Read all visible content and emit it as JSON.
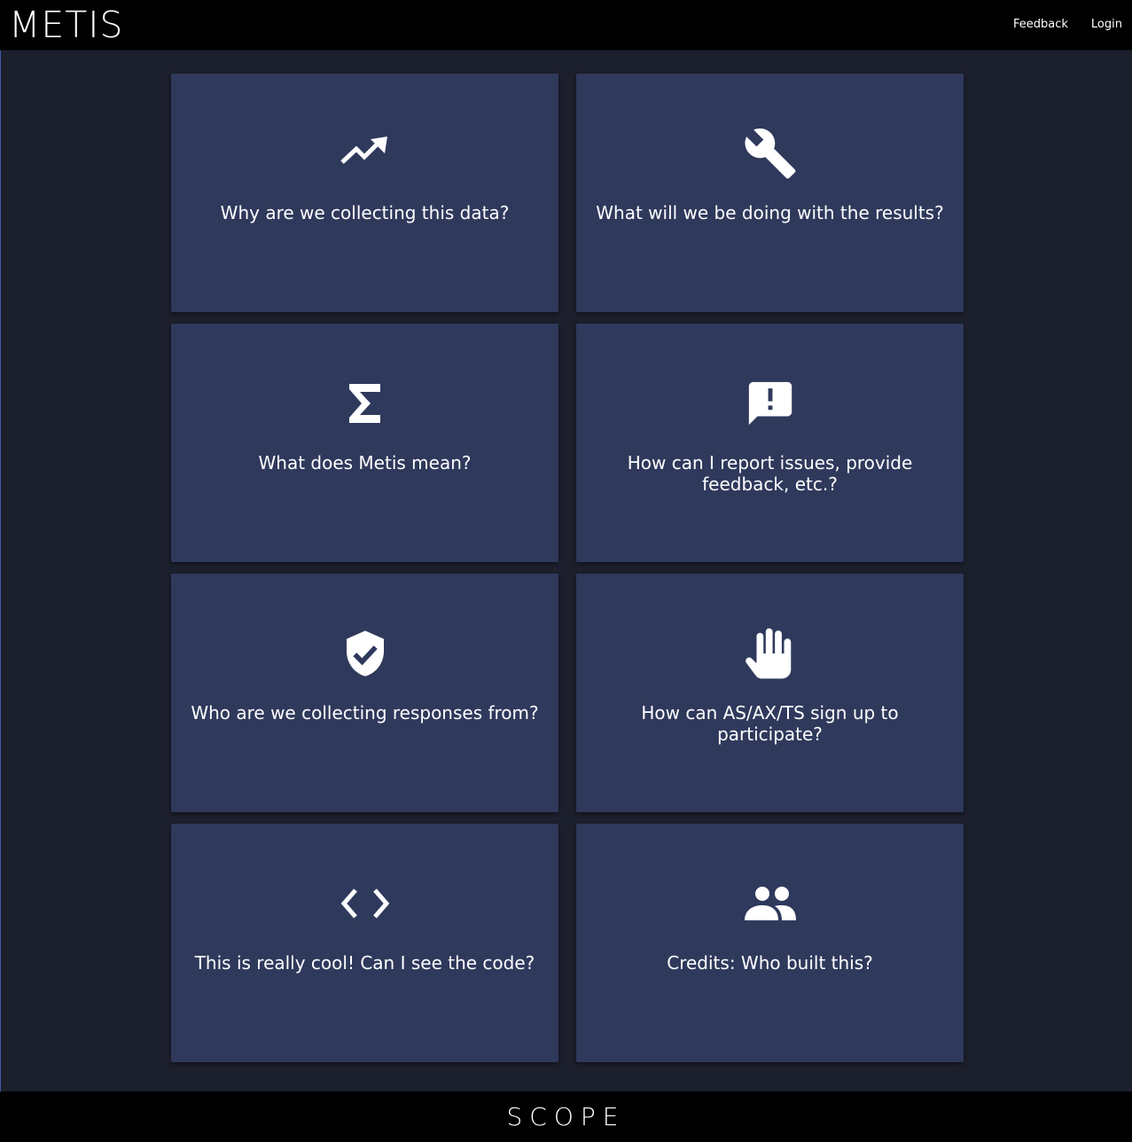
{
  "header": {
    "brand": "METIS",
    "nav": [
      {
        "label": "Feedback"
      },
      {
        "label": "Login"
      }
    ]
  },
  "cards": [
    {
      "icon": "trending-up-icon",
      "label": "Why are we collecting this data?"
    },
    {
      "icon": "wrench-icon",
      "label": "What will we be doing with the results?"
    },
    {
      "icon": "sigma-icon",
      "label": "What does Metis mean?"
    },
    {
      "icon": "feedback-alert-icon",
      "label": "How can I report issues, provide feedback, etc.?"
    },
    {
      "icon": "shield-check-icon",
      "label": "Who are we collecting responses from?"
    },
    {
      "icon": "raised-hand-icon",
      "label": "How can AS/AX/TS sign up to participate?"
    },
    {
      "icon": "code-brackets-icon",
      "label": "This is really cool! Can I see the code?"
    },
    {
      "icon": "people-icon",
      "label": "Credits: Who built this?"
    }
  ],
  "footer": {
    "logo": "SCOPE"
  },
  "colors": {
    "background": "#1c1f2c",
    "card": "#2f395c",
    "bar": "#000000",
    "text": "#ffffff"
  }
}
